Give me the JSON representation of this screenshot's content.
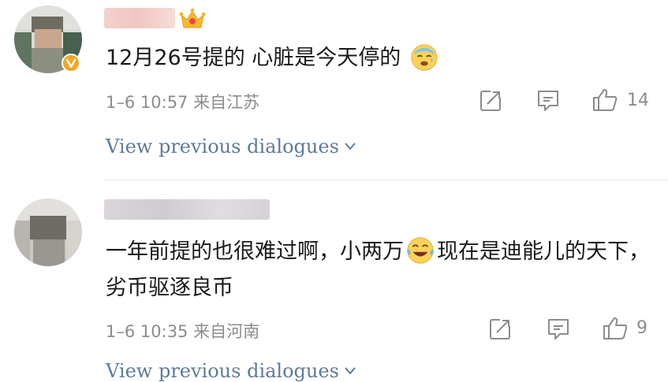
{
  "comments": [
    {
      "text": "12月26号提的 心脏是今天停的",
      "emoji": "dizzy-sweat-emoji",
      "meta": "1–6 10:57  来自江苏",
      "like_count": "14",
      "view_previous": "View previous dialogues"
    },
    {
      "text_part1": "一年前提的也很难过啊，小两万",
      "emoji": "laughing-tears-emoji",
      "text_part2": "现在是迪能儿的天下，劣币驱逐良币",
      "meta": "1–6 10:35  来自河南",
      "like_count": "9",
      "view_previous": "View previous dialogues"
    }
  ],
  "colors": {
    "link": "#5d7a9d",
    "meta": "#8c8c8c",
    "badge": "#f4a623"
  }
}
